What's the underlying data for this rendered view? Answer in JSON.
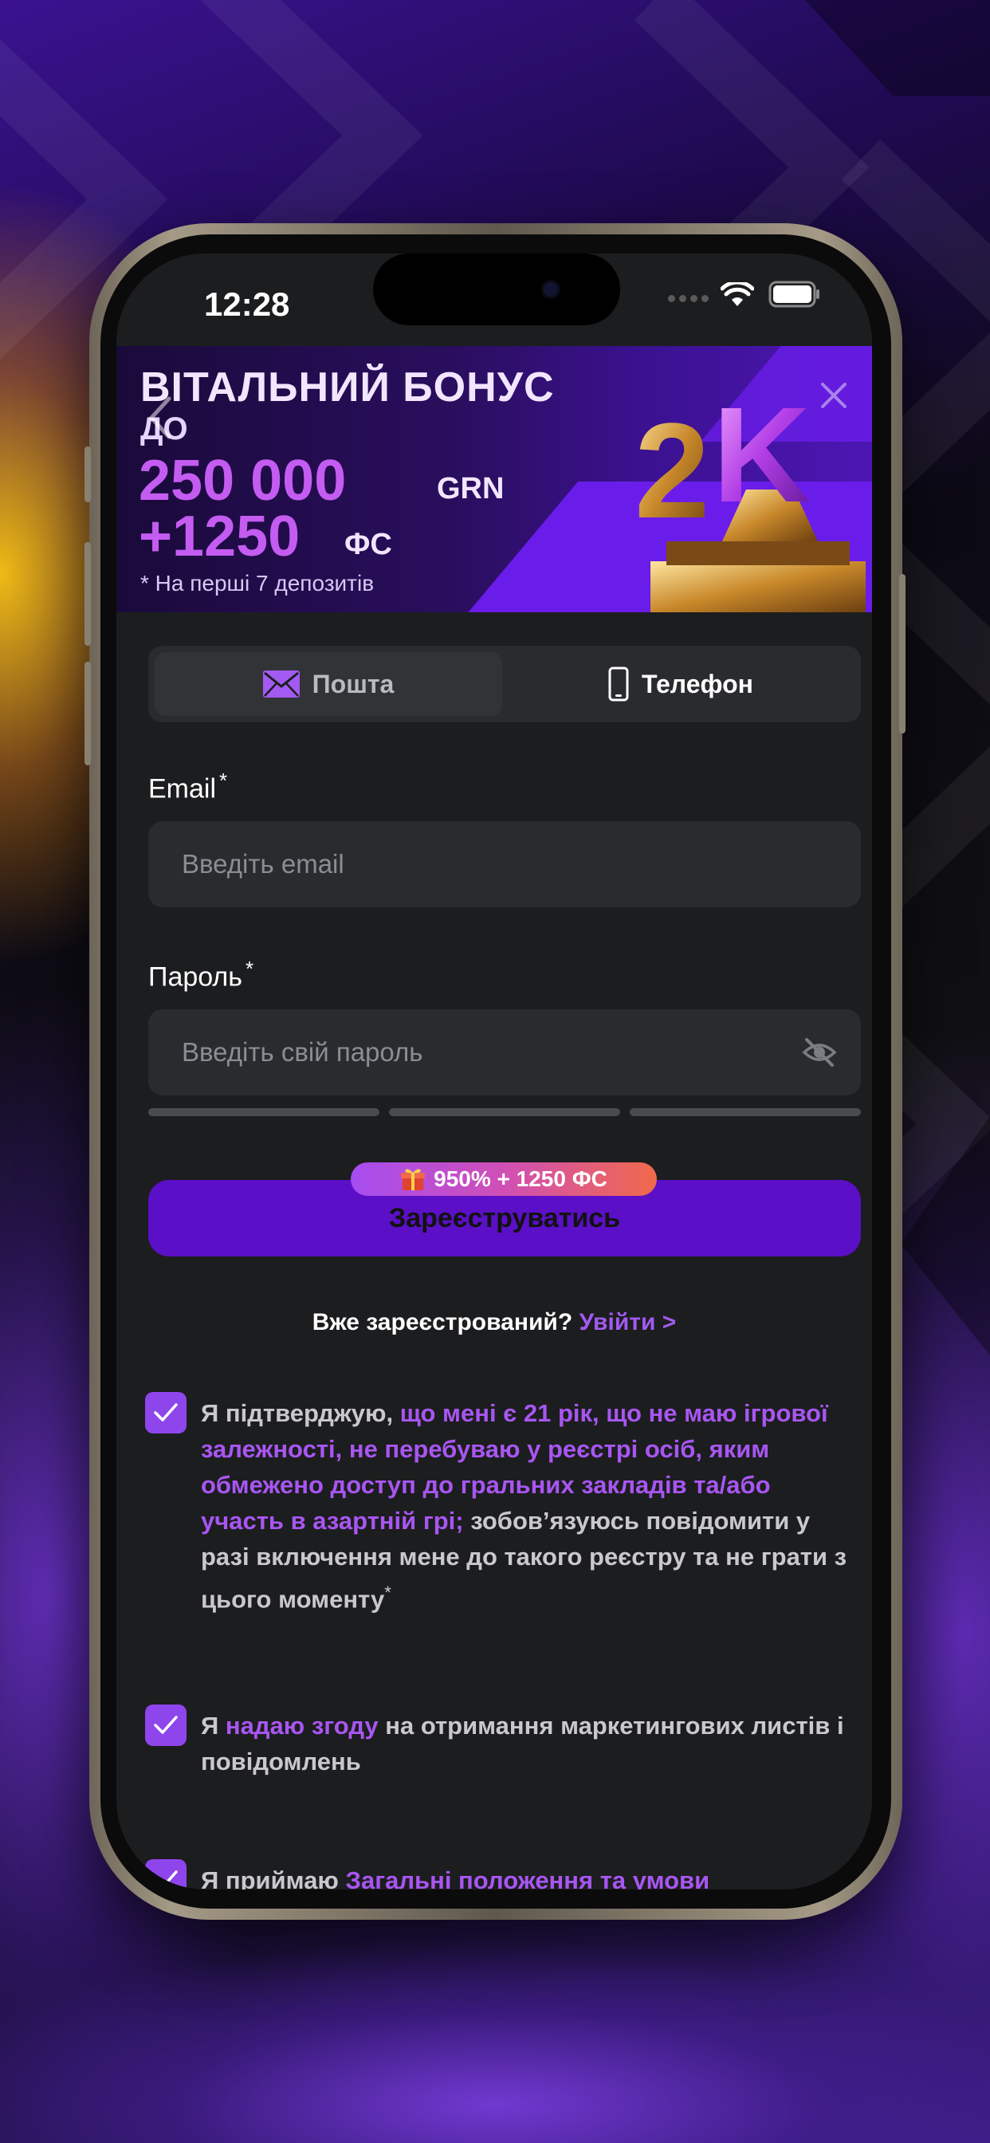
{
  "status_bar": {
    "time": "12:28"
  },
  "banner": {
    "line1": "ВІТАЛЬНИЙ БОНУС",
    "line2": "ДО",
    "amount": "250 000",
    "currency": "GRN",
    "fs_amount": "+1250",
    "fs_unit": "ФС",
    "note": "* На перші 7 депозитів",
    "trophy_text": "2K"
  },
  "tabs": {
    "email_label": "Пошта",
    "phone_label": "Телефон",
    "selected": "email"
  },
  "form": {
    "email": {
      "label": "Email",
      "required": "*",
      "placeholder": "Введіть email",
      "value": ""
    },
    "password": {
      "label": "Пароль",
      "required": "*",
      "placeholder": "Введіть свій пароль",
      "value": ""
    },
    "strength_segments": 3,
    "bonus_chip": "950% + 1250 ФС",
    "bonus_icon": "gift-icon",
    "register_label": "Зареєструватись"
  },
  "login": {
    "prompt": "Вже зареєстрований?",
    "link": "Увійти  >"
  },
  "consents": [
    {
      "checked": true,
      "p1": "Я підтверджую, ",
      "p2": "що мені є 21 рік, що не маю ігрової залежності, не перебуваю у реєстрі осіб, яким обмежено доступ до гральних закладів та/або участь в азартній грі;",
      "p3": " зобов’язуюсь повідомити у разі включення мене до такого реєстру та не грати з цього моменту",
      "required": "*"
    },
    {
      "checked": true,
      "p1": "Я ",
      "p2": "надаю згоду",
      "p3": " на отримання маркетингових листів і повідомлень"
    },
    {
      "checked": true,
      "p1": "Я приймаю ",
      "p2": "Загальні положення та умови"
    }
  ],
  "colors": {
    "accent": "#a856f2",
    "button": "#5b0fc6",
    "input_bg": "#2a2b2e",
    "screen_bg": "#1c1d1f"
  }
}
